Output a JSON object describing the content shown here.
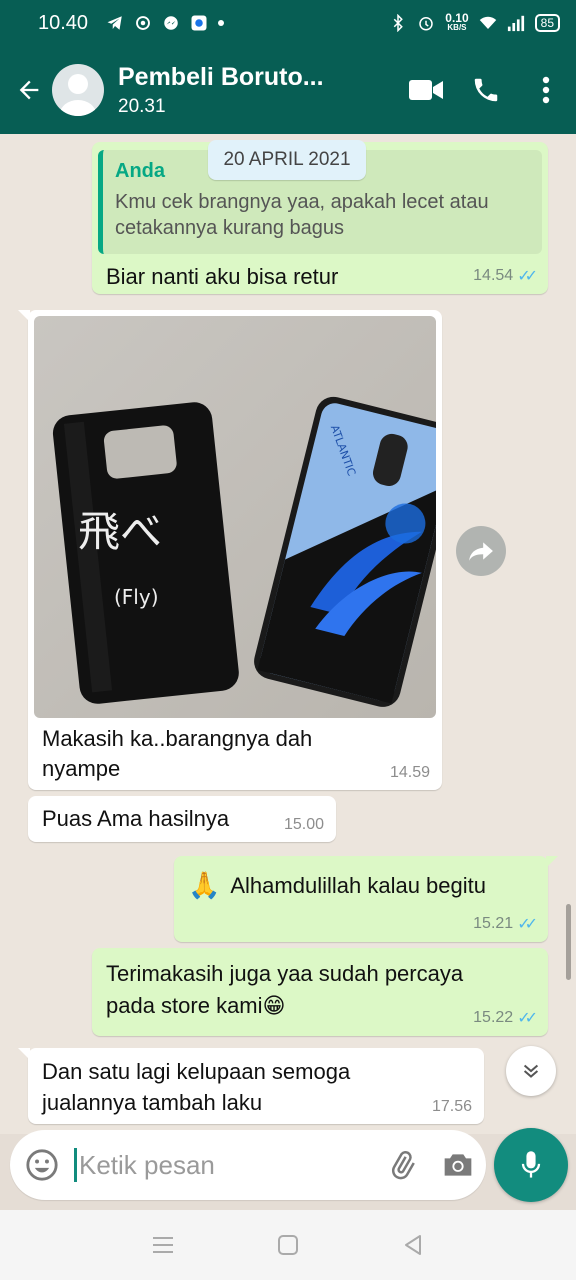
{
  "status_bar": {
    "time": "10.40",
    "net_speed_value": "0.10",
    "net_speed_unit": "KB/S",
    "battery": "85"
  },
  "header": {
    "contact_name": "Pembeli Boruto...",
    "subtitle": "20.31",
    "icons": [
      "back-arrow-icon",
      "video-call-icon",
      "phone-icon",
      "more-icon"
    ]
  },
  "chat": {
    "date_chip": "20 APRIL 2021",
    "messages": [
      {
        "direction": "out",
        "quote_author": "Anda",
        "quote_lines": [
          "Kmu cek brangnya yaa, apakah lecet atau",
          "cetakannya kurang bagus"
        ],
        "text": "Biar nanti aku bisa retur",
        "time": "14.54",
        "status": "read"
      },
      {
        "direction": "in",
        "has_image": true,
        "image_text": [
          "飛べ",
          "(Fly)",
          "ATLANTIC"
        ],
        "text_lines": [
          "Makasih ka..barangnya dah",
          "nyampe"
        ],
        "time": "14.59"
      },
      {
        "direction": "in",
        "text": "Puas Ama hasilnya",
        "time": "15.00"
      },
      {
        "direction": "out",
        "emoji": "🙏",
        "text": "Alhamdulillah kalau begitu",
        "time": "15.21",
        "status": "read"
      },
      {
        "direction": "out",
        "text_lines": [
          "Terimakasih juga yaa sudah percaya",
          "pada store kami"
        ],
        "emoji": "😁",
        "time": "15.22",
        "status": "read"
      },
      {
        "direction": "in",
        "text_lines": [
          "Dan satu lagi kelupaan semoga",
          "jualannya tambah laku"
        ],
        "time": "17.56"
      }
    ]
  },
  "composer": {
    "placeholder": "Ketik pesan",
    "icons": [
      "emoji-icon",
      "attach-icon",
      "camera-icon",
      "mic-icon"
    ]
  },
  "colors": {
    "header": "#075e54",
    "outgoing_bubble": "#dcf8c6",
    "incoming_bubble": "#ffffff",
    "accent": "#128c7e",
    "read_ticks": "#4fb6ec"
  }
}
